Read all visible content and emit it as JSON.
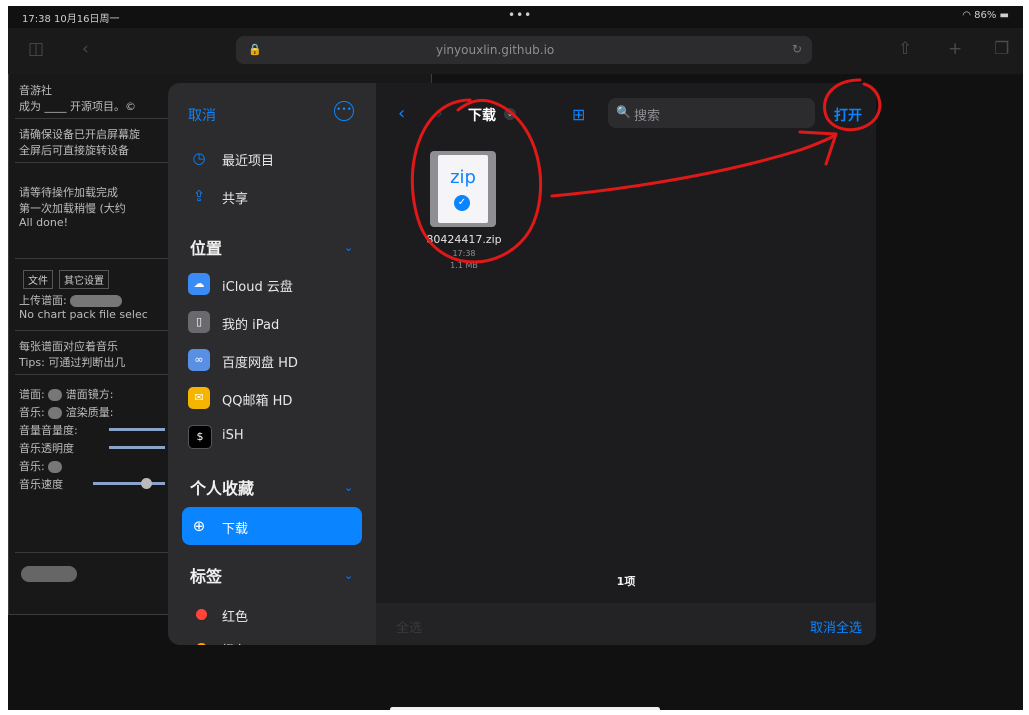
{
  "status_bar": {
    "time": "17:38 10月16日周一",
    "dots": "•••",
    "battery": "86%"
  },
  "safari": {
    "url": "yinyouxlin.github.io",
    "url_lock": "🔒",
    "reload": "↻"
  },
  "web_panel": {
    "lines": [
      "音游社",
      "成为 ____ 开源项目。©",
      "请确保设备已开启屏幕旋",
      "全屏后可直接旋转设备",
      "请等待操作加载完成",
      "第一次加载稍慢 (大约",
      "All done!",
      "上传谱面:",
      "No chart pack file selec",
      "每张谱面对应着音乐",
      "Tips: 可通过判断出几",
      "谱面:",
      "谱面镜方:",
      "音乐:",
      "渲染质量:",
      "音量音量度:",
      "音乐透明度",
      "音乐:",
      "音乐速度"
    ],
    "tabs": [
      "文件",
      "其它设置"
    ]
  },
  "dialog": {
    "cancel_label": "取消",
    "more_icon": "•••",
    "sidebar": {
      "recent_items": [
        {
          "label": "最近项目",
          "icon": "clock-icon",
          "glyph": "◷"
        },
        {
          "label": "共享",
          "icon": "shared-folder-icon",
          "glyph": "⇪"
        }
      ],
      "locations_header": "位置",
      "locations": [
        {
          "label": "iCloud 云盘",
          "icon": "icloud-icon",
          "color": "#3a8bf5",
          "glyph": "☁"
        },
        {
          "label": "我的 iPad",
          "icon": "ipad-icon",
          "color": "#6a6a6e",
          "glyph": "▯"
        },
        {
          "label": "百度网盘 HD",
          "icon": "baidu-netdisk-icon",
          "color": "#5a8fe6",
          "glyph": "∞"
        },
        {
          "label": "QQ邮箱 HD",
          "icon": "qq-mail-icon",
          "color": "#f5b400",
          "glyph": "✉"
        },
        {
          "label": "iSH",
          "icon": "ish-icon",
          "color": "#000000",
          "glyph": "$"
        }
      ],
      "favorites_header": "个人收藏",
      "favorites": [
        {
          "label": "下载",
          "icon": "download-icon",
          "glyph": "⊕",
          "active": true
        }
      ],
      "tags_header": "标签",
      "tags": [
        {
          "label": "红色",
          "color": "#ff453a"
        },
        {
          "label": "橙色",
          "color": "#ff9f0a"
        }
      ]
    },
    "main": {
      "back_icon": "‹",
      "forward_icon": "›",
      "folder_title": "下载",
      "folder_chevron": "⌄",
      "grid_icon": "⊞",
      "search_icon": "🔍",
      "search_placeholder": "搜索",
      "open_label": "打开",
      "file": {
        "ext_label": "zip",
        "badge": "✓",
        "name": "80424417.zip",
        "time": "17:38",
        "size": "1.1 MB"
      },
      "count_label": "1项",
      "select_all_label": "全选",
      "deselect_all_label": "取消全选"
    }
  },
  "annotation_color": "#e01818"
}
